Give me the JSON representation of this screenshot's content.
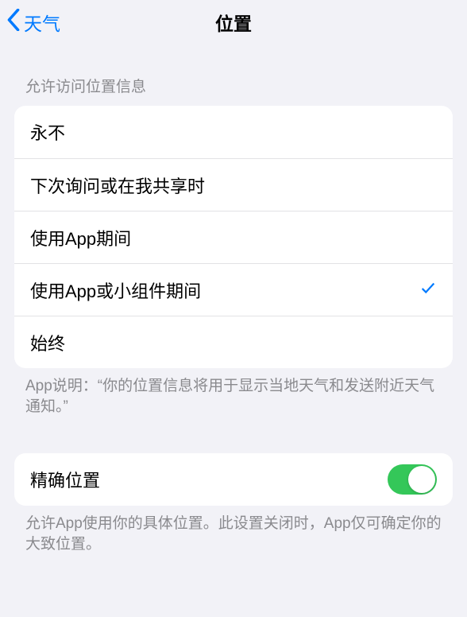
{
  "nav": {
    "back_label": "天气",
    "title": "位置"
  },
  "section1": {
    "header": "允许访问位置信息",
    "options": {
      "never": "永不",
      "ask": "下次询问或在我共享时",
      "using": "使用App期间",
      "using_widget": "使用App或小组件期间",
      "always": "始终"
    },
    "selected_key": "using_widget",
    "footer": "App说明：“你的位置信息将用于显示当地天气和发送附近天气通知。”"
  },
  "section2": {
    "precise_label": "精确位置",
    "precise_on": true,
    "footer": "允许App使用你的具体位置。此设置关闭时，App仅可确定你的大致位置。"
  }
}
